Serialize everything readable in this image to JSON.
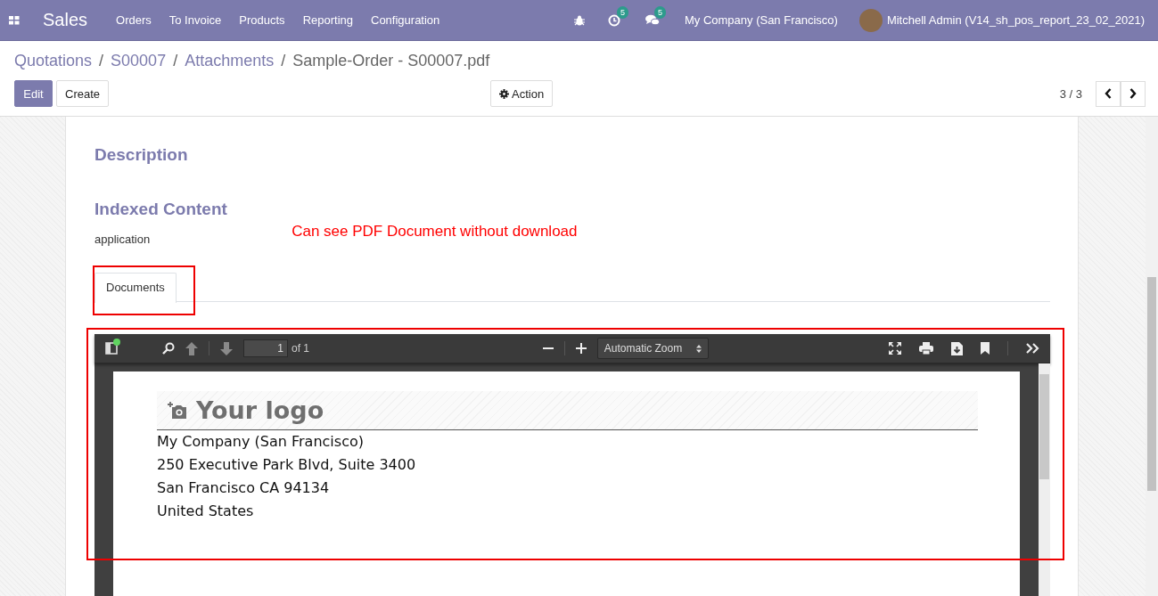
{
  "navbar": {
    "app": "Sales",
    "menu": [
      "Orders",
      "To Invoice",
      "Products",
      "Reporting",
      "Configuration"
    ],
    "activity_count": "5",
    "message_count": "5",
    "company": "My Company (San Francisco)",
    "user": "Mitchell Admin (V14_sh_pos_report_23_02_2021)"
  },
  "breadcrumb": [
    {
      "label": "Quotations",
      "link": true
    },
    {
      "separator": "/",
      "label": "S00007",
      "link": true
    },
    {
      "separator": "/",
      "label": "Attachments",
      "link": true
    },
    {
      "separator": "/",
      "label": "Sample-Order - S00007.pdf",
      "link": false
    }
  ],
  "buttons": {
    "edit": "Edit",
    "create": "Create",
    "action": "Action"
  },
  "pager": "3 / 3",
  "sheet": {
    "description_title": "Description",
    "indexed_title": "Indexed Content",
    "indexed_value": "application",
    "annotation": "Can see PDF Document without download",
    "tabs": [
      {
        "label": "Documents",
        "selected": true
      }
    ]
  },
  "pdf": {
    "page": "1",
    "page_count": "of 1",
    "zoom": "Automatic Zoom",
    "logo": "Your logo",
    "address": [
      "My Company (San Francisco)",
      "250 Executive Park Blvd, Suite 3400",
      "San Francisco CA 94134",
      "United States"
    ]
  }
}
